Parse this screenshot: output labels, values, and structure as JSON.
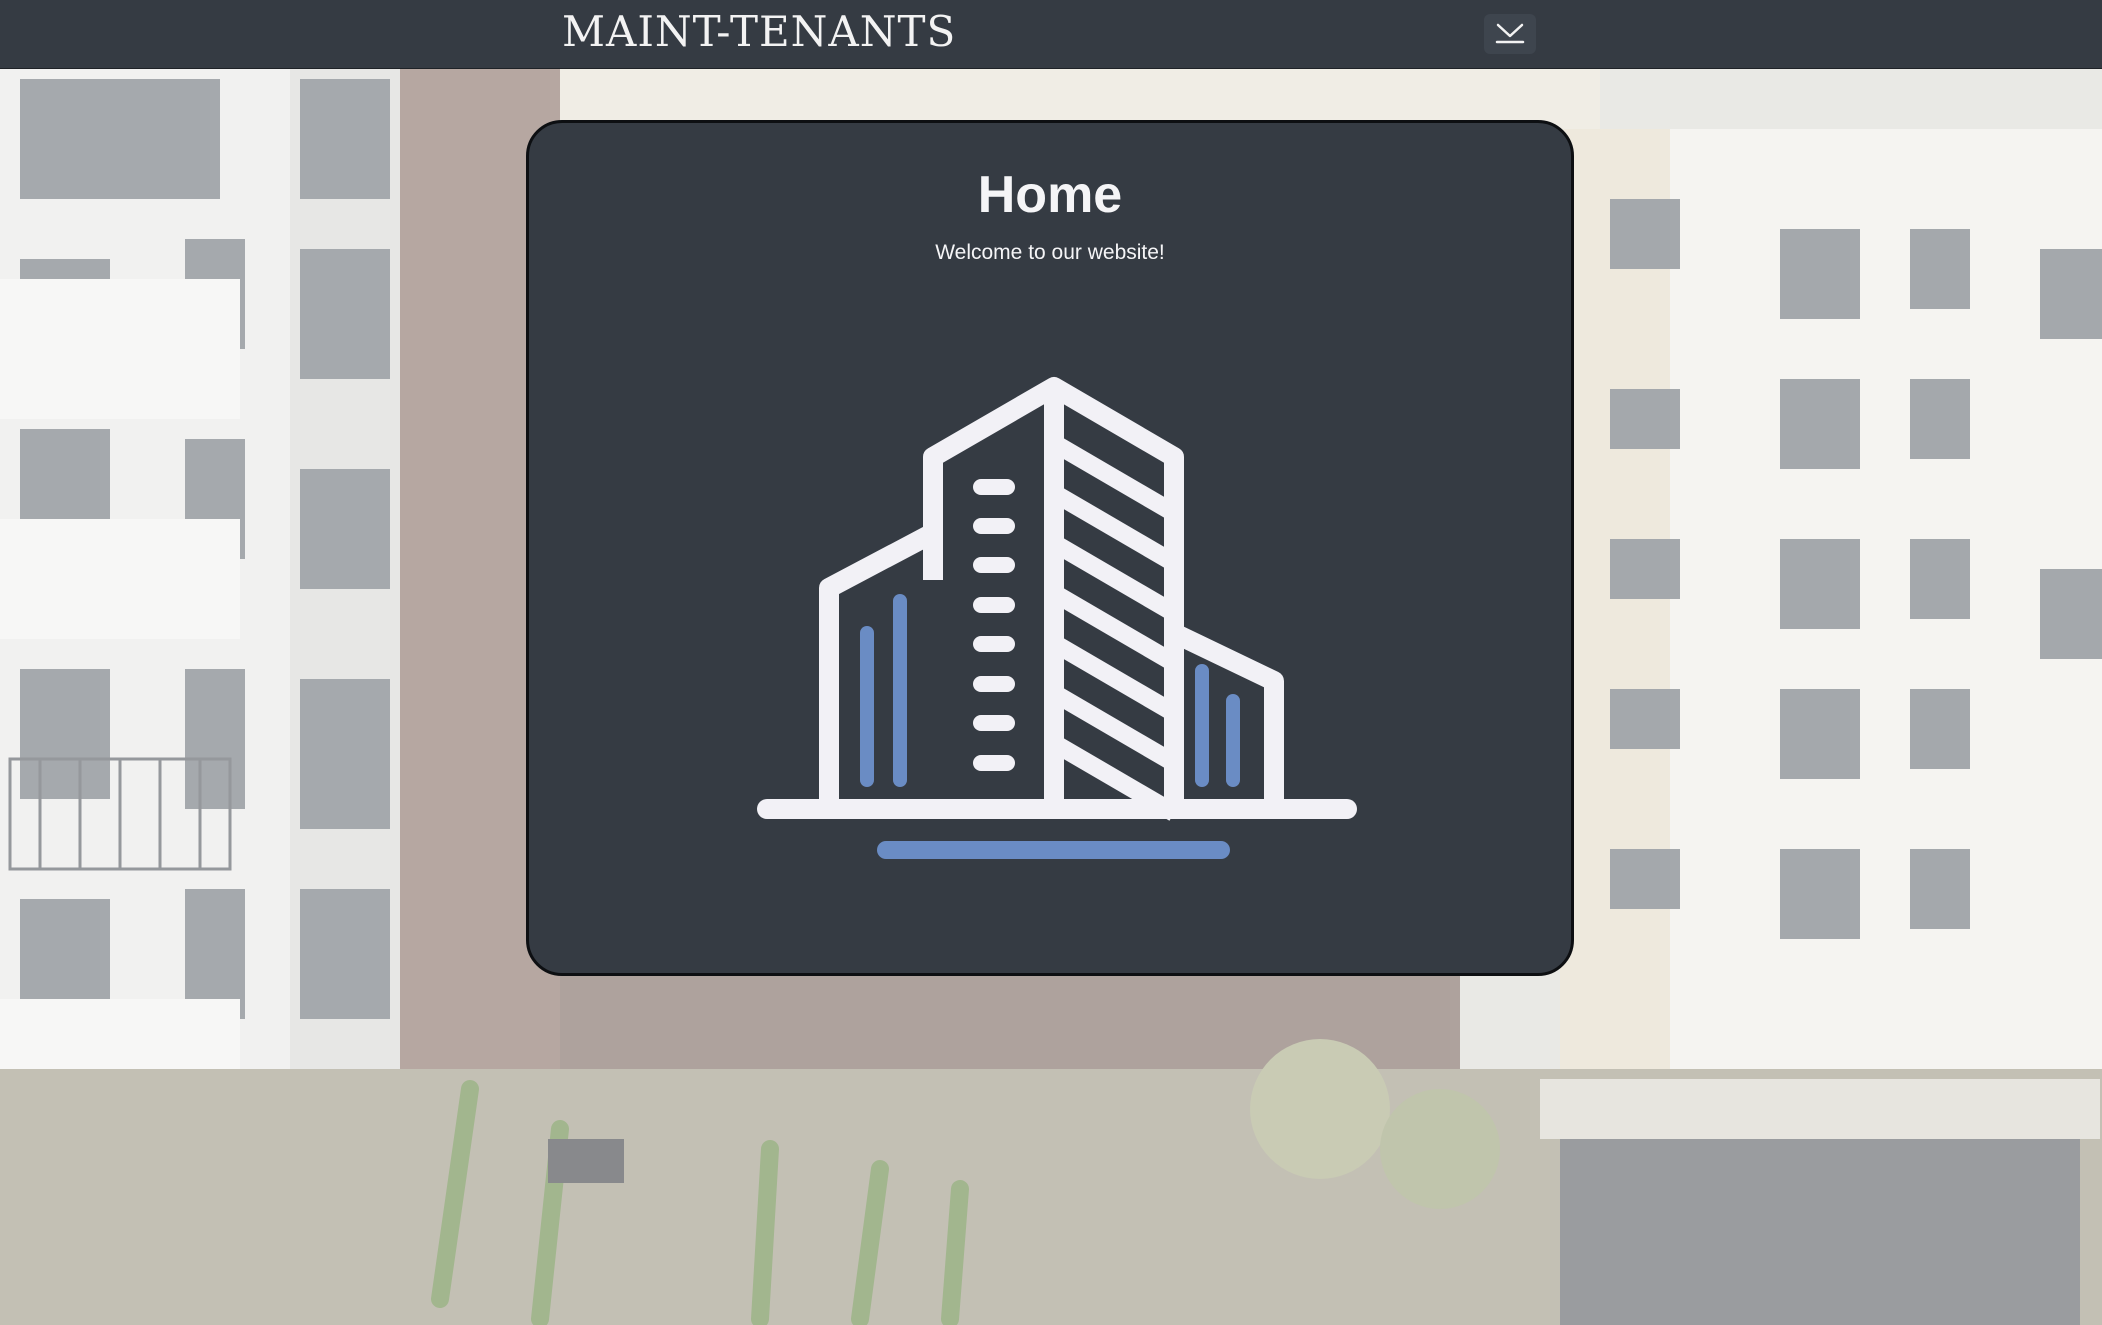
{
  "header": {
    "brand": "MAINT-TENANTS",
    "menu_toggle_icon": "chevron-down-icon"
  },
  "card": {
    "title": "Home",
    "subtitle": "Welcome to our website!",
    "illustration_icon": "office-building-icon"
  },
  "colors": {
    "navbar": "#353b43",
    "card": "#353b43",
    "text": "#f5f5f7",
    "accent": "#6a8cc4"
  }
}
